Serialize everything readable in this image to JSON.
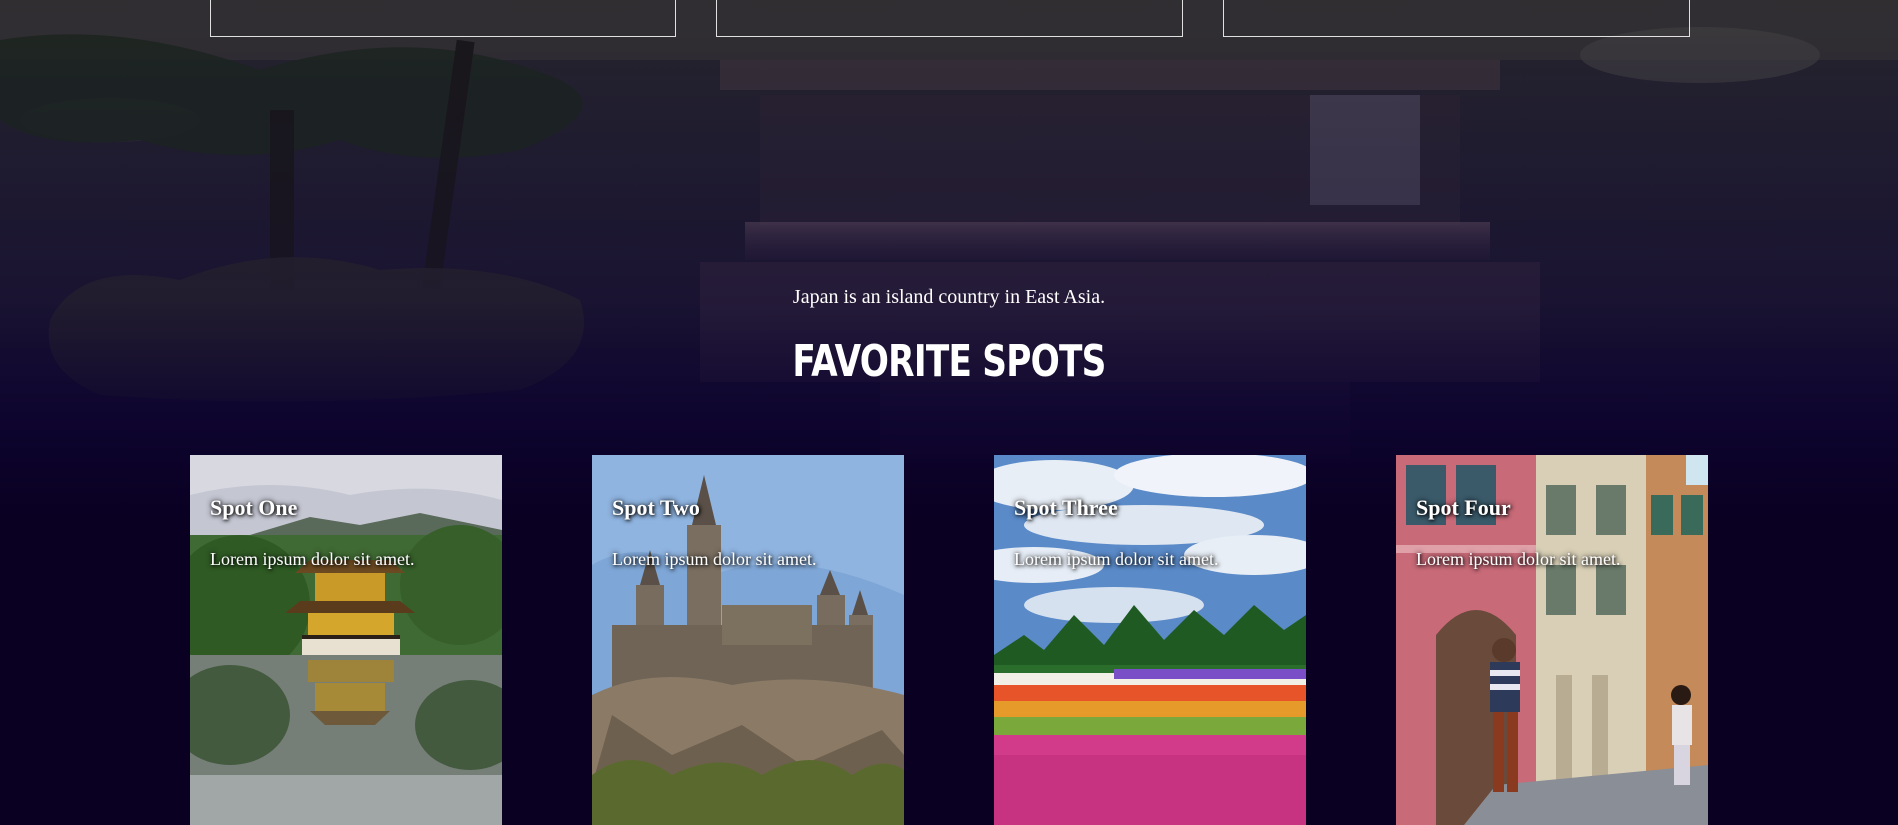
{
  "intro_text": "Japan is an island country in East Asia.",
  "section_title": "FAVORITE SPOTS",
  "cards": [
    {
      "title": "Spot One",
      "text": "Lorem ipsum dolor sit amet.",
      "image": "golden-pavilion-image"
    },
    {
      "title": "Spot Two",
      "text": "Lorem ipsum dolor sit amet.",
      "image": "castle-image"
    },
    {
      "title": "Spot Three",
      "text": "Lorem ipsum dolor sit amet.",
      "image": "flower-field-image"
    },
    {
      "title": "Spot Four",
      "text": "Lorem ipsum dolor sit amet.",
      "image": "street-scene-image"
    }
  ],
  "colors": {
    "page_background": "#0a0022",
    "text": "#ffffff"
  }
}
